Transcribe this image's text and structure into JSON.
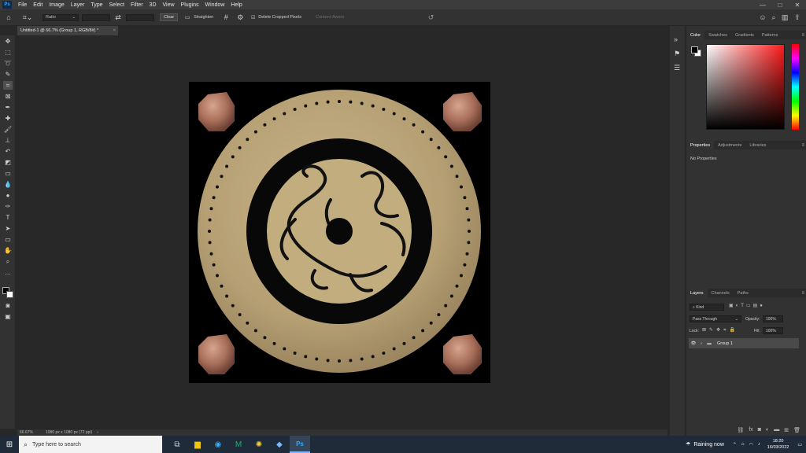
{
  "app": {
    "logo_text": "Ps",
    "brand_color": "#31a8ff"
  },
  "menu": [
    "File",
    "Edit",
    "Image",
    "Layer",
    "Type",
    "Select",
    "Filter",
    "3D",
    "View",
    "Plugins",
    "Window",
    "Help"
  ],
  "window_controls": [
    "—",
    "□",
    "✕"
  ],
  "options": {
    "ratio_label": "Ratio",
    "clear_label": "Clear",
    "straighten_label": "Straighten",
    "delete_cropped_label": "Delete Cropped Pixels",
    "delete_cropped_checked": true,
    "content_aware_label": "Content-Aware"
  },
  "document_tab": {
    "title": "Untitled-1 @ 66.7% (Group 1, RGB/8#) *",
    "close": "×"
  },
  "statusbar": {
    "zoom": "66.67%",
    "doc_info": "1080 px x 1080 px (72 ppi)"
  },
  "color_panel": {
    "tabs": [
      "Color",
      "Swatches",
      "Gradients",
      "Patterns"
    ],
    "active": "Color",
    "fg": "#000000",
    "bg": "#ffffff"
  },
  "properties_panel": {
    "tabs": [
      "Properties",
      "Adjustments",
      "Libraries"
    ],
    "active": "Properties",
    "message": "No Properties"
  },
  "layers_panel": {
    "tabs": [
      "Layers",
      "Channels",
      "Paths"
    ],
    "active": "Layers",
    "filter_kind": "Kind",
    "blend_mode": "Pass Through",
    "opacity_label": "Opacity:",
    "opacity_value": "100%",
    "lock_label": "Lock:",
    "fill_label": "Fill:",
    "fill_value": "100%",
    "layers": [
      {
        "name": "Group 1",
        "visible": true,
        "type": "group"
      }
    ]
  },
  "taskbar": {
    "search_placeholder": "Type here to search",
    "weather": "Raining now",
    "time": "18:20",
    "date": "16/03/2022"
  }
}
